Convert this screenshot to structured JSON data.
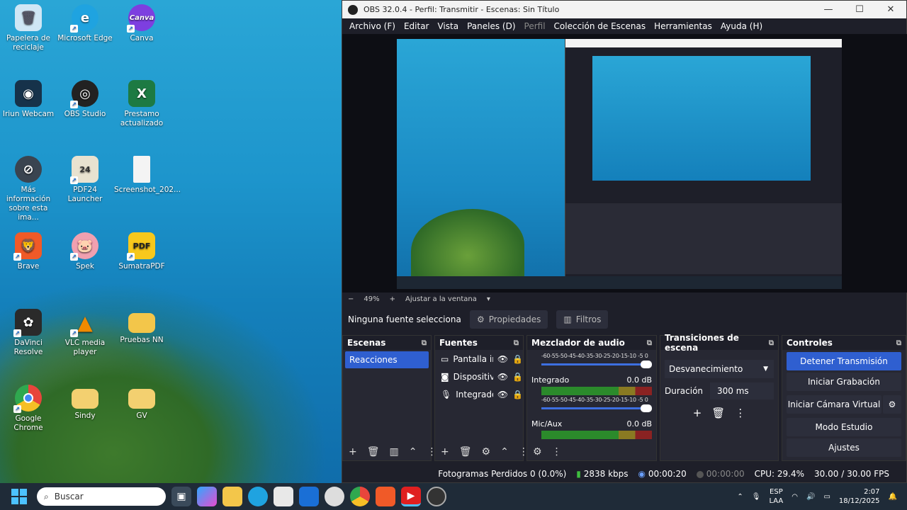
{
  "desktop": {
    "icons": [
      {
        "label": "Papelera de reciclaje",
        "icon": "recycle-bin-icon",
        "color": "#cfe6f5"
      },
      {
        "label": "Microsoft Edge",
        "icon": "edge-icon",
        "color": "#1fa3e0"
      },
      {
        "label": "Canva",
        "icon": "canva-icon",
        "color": "#7d3fe0",
        "glyph": "Canva"
      },
      {
        "label": "Iriun Webcam",
        "icon": "webcam-icon",
        "color": "#16324a"
      },
      {
        "label": "OBS Studio",
        "icon": "obs-icon",
        "color": "#222222"
      },
      {
        "label": "Prestamo actualizado",
        "icon": "excel-icon",
        "color": "#1d7a43"
      },
      {
        "label": "Más información sobre esta ima...",
        "icon": "info-icon",
        "color": "#3a4450"
      },
      {
        "label": "PDF24 Launcher",
        "icon": "pdf24-icon",
        "color": "#e8e2d0"
      },
      {
        "label": "Screenshot_202...",
        "icon": "file-icon",
        "color": "#f4f4f4"
      },
      {
        "label": "Brave",
        "icon": "brave-icon",
        "color": "#f05a28"
      },
      {
        "label": "Spek",
        "icon": "spek-icon",
        "color": "#f0a0b0"
      },
      {
        "label": "SumatraPDF",
        "icon": "sumatrapdf-icon",
        "color": "#f7c81c",
        "glyph": "PDF"
      },
      {
        "label": "DaVinci Resolve",
        "icon": "davinci-icon",
        "color": "#2a2a2a"
      },
      {
        "label": "VLC media player",
        "icon": "vlc-icon",
        "color": "#f08a00"
      },
      {
        "label": "Pruebas NN",
        "icon": "folder-icon",
        "color": "#f3c64a"
      },
      {
        "label": "Google Chrome",
        "icon": "chrome-icon",
        "color": "#e8453c"
      },
      {
        "label": "Sindy",
        "icon": "folder-icon",
        "color": "#f3d070"
      },
      {
        "label": "GV",
        "icon": "folder-icon",
        "color": "#f3d070"
      }
    ]
  },
  "obs": {
    "title": "OBS 32.0.4 - Perfil: Transmitir - Escenas: Sin Título",
    "menu": [
      "Archivo (F)",
      "Editar",
      "Vista",
      "Paneles (D)",
      "Perfil",
      "Colección de Escenas",
      "Herramientas",
      "Ayuda (H)"
    ],
    "zoom": "49%",
    "fit": "Ajustar a la ventana",
    "no_source": "Ninguna fuente selecciona",
    "properties": "Propiedades",
    "filters": "Filtros",
    "scenes": {
      "title": "Escenas",
      "items": [
        "Reacciones"
      ]
    },
    "sources": {
      "title": "Fuentes",
      "items": [
        {
          "name": "Pantalla ir",
          "icon": "monitor-icon"
        },
        {
          "name": "Dispositiv",
          "icon": "camera-icon"
        },
        {
          "name": "Integrado",
          "icon": "microphone-icon"
        }
      ]
    },
    "mixer": {
      "title": "Mezclador de audio",
      "scale": "-60-55-50-45-40-35-30-25-20-15-10 -5 0",
      "channels": [
        {
          "name": "Integrado",
          "db": "0.0 dB"
        },
        {
          "name": "Mic/Aux",
          "db": "0.0 dB"
        }
      ]
    },
    "transitions": {
      "title": "Transiciones de escena",
      "selected": "Desvanecimiento",
      "duration_label": "Duración",
      "duration": "300 ms"
    },
    "controls": {
      "title": "Controles",
      "stop_stream": "Detener Transmisión",
      "start_recording": "Iniciar Grabación",
      "virtual_cam": "Iniciar Cámara Virtual",
      "studio_mode": "Modo Estudio",
      "settings": "Ajustes"
    },
    "status": {
      "dropped": "Fotogramas Perdidos 0 (0.0%)",
      "bitrate": "2838 kbps",
      "stream_time": "00:00:20",
      "rec_time": "00:00:00",
      "cpu": "CPU: 29.4%",
      "fps": "30.00 / 30.00 FPS"
    }
  },
  "taskbar": {
    "search": "Buscar",
    "apps": [
      "task-view-icon",
      "copilot-icon",
      "file-explorer-icon",
      "edge-icon",
      "store-icon",
      "outlook-icon",
      "obs-icon",
      "chrome-icon",
      "brave-icon",
      "youtube-icon",
      "obs-recording-icon"
    ],
    "lang": "ESP",
    "region": "LAA",
    "time": "2:07",
    "date": "18/12/2025"
  }
}
